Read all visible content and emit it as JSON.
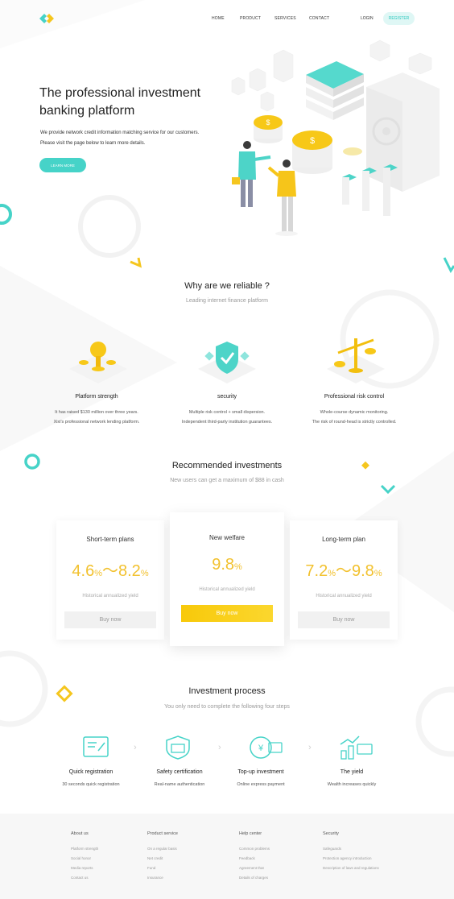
{
  "nav": {
    "links": [
      "HOME",
      "PRODUCT",
      "SERVICES",
      "CONTACT"
    ],
    "login": "LOGIN",
    "register": "REGISTER"
  },
  "hero": {
    "title_line1": "The professional investment",
    "title_line2": "banking platform",
    "desc_line1": "We provide network credit information matching service for our customers.",
    "desc_line2": "Please visit the page below to learn more details.",
    "cta": "LEARN MORE"
  },
  "reliable": {
    "title": "Why are we reliable ?",
    "subtitle": "Leading internet finance platform",
    "features": [
      {
        "title": "Platform strength",
        "line1": "It has raised $130 million over three years.",
        "line2": "Xixi's professional network lending platform."
      },
      {
        "title": "security",
        "line1": "Multiple risk control + small dispersion.",
        "line2": "Independent third-party institution guarantees."
      },
      {
        "title": "Professional risk control",
        "line1": "Whole-course dynamic monitoring.",
        "line2": "The risk of round-head is strictly controlled."
      }
    ]
  },
  "recommended": {
    "title": "Recommended investments",
    "subtitle": "New users can get a maximum of $88 in cash",
    "cards": [
      {
        "title": "Short-term plans",
        "rate_a": "4.6",
        "rate_b": "8.2",
        "unit": "%",
        "sep": "～",
        "note": "Historical annualized yield",
        "button": "Buy now"
      },
      {
        "title": "New welfare",
        "rate_a": "9.8",
        "unit": "%",
        "note": "Historical annualized yield",
        "button": "Buy now"
      },
      {
        "title": "Long-term plan",
        "rate_a": "7.2",
        "rate_b": "9.8",
        "unit": "%",
        "sep": "～",
        "note": "Historical annualized yield",
        "button": "Buy now"
      }
    ]
  },
  "process": {
    "title": "Investment process",
    "subtitle": "You only need to complete the following four steps",
    "steps": [
      {
        "title": "Quick registration",
        "text": "30 seconds quick registration"
      },
      {
        "title": "Safety certification",
        "text": "Real-name authentication"
      },
      {
        "title": "Top-up investment",
        "text": "Online express payment"
      },
      {
        "title": "The yield",
        "text": "Wealth increases quickly"
      }
    ]
  },
  "footer": {
    "columns": [
      {
        "title": "About us",
        "links": [
          "Platform strength",
          "Social honor",
          "Media reports",
          "Contact us"
        ]
      },
      {
        "title": "Product service",
        "links": [
          "On a regular basis",
          "Net credit",
          "Fund",
          "Insurance"
        ]
      },
      {
        "title": "Help center",
        "links": [
          "Common problems",
          "Feedback",
          "Agreement that",
          "Details of charges"
        ]
      },
      {
        "title": "Security",
        "links": [
          "Safeguards",
          "Protection agency introduction",
          "Description of laws and regulations"
        ]
      }
    ]
  },
  "colors": {
    "accent": "#46d3c8",
    "gold": "#f2c12e",
    "text": "#222222"
  }
}
